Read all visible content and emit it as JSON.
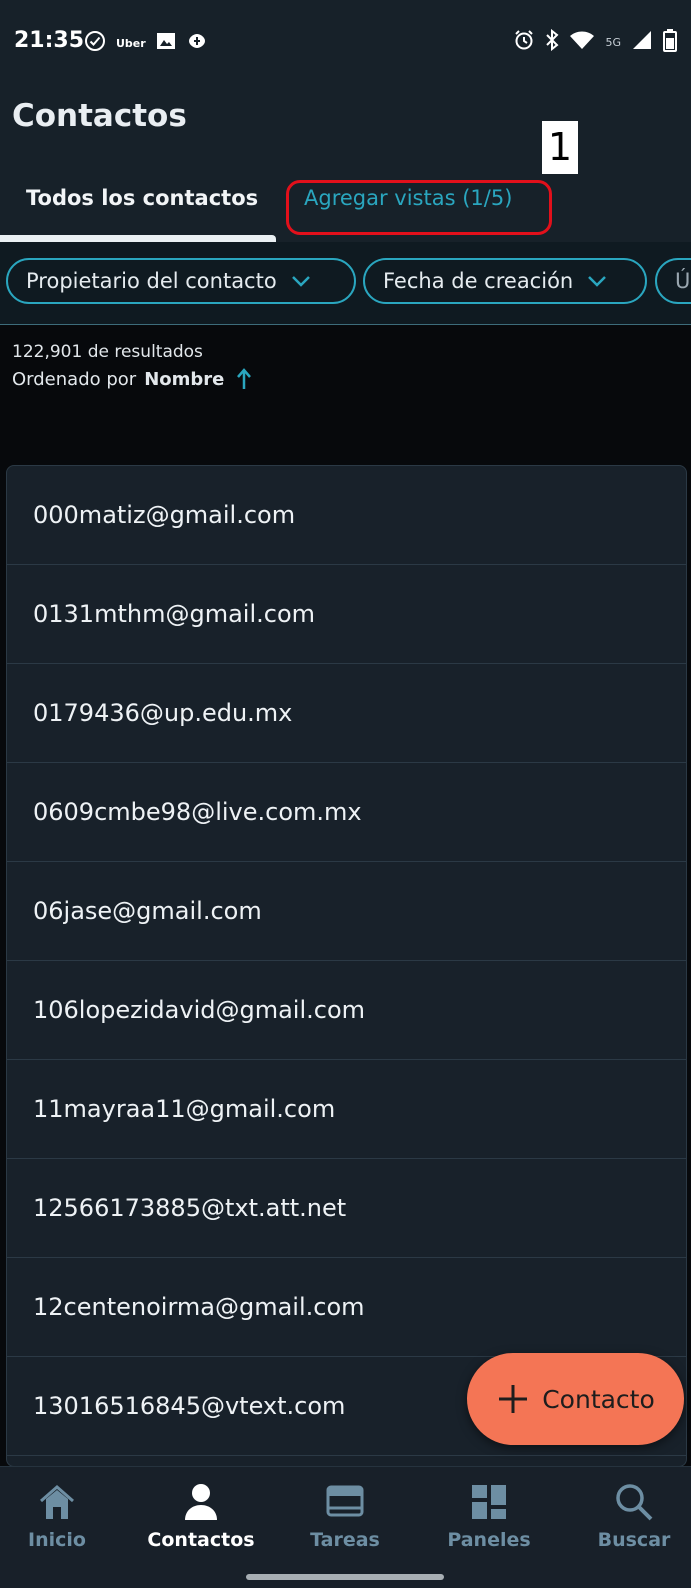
{
  "status_bar": {
    "time": "21:35",
    "uber_label": "Uber",
    "network": "5G",
    "left_icons": [
      "check-circle-icon",
      "uber-icon",
      "image-icon",
      "app-icon"
    ],
    "right_icons": [
      "alarm-icon",
      "bluetooth-icon",
      "wifi-icon",
      "signal-icon",
      "battery-icon"
    ]
  },
  "header": {
    "title": "Contactos",
    "tabs": [
      {
        "label": "Todos los contactos",
        "active": true
      },
      {
        "label": "Agregar vistas (1/5)",
        "active": false
      }
    ]
  },
  "annotation": {
    "label": "1",
    "ring_color": "#e2101b"
  },
  "filters": {
    "chips": [
      {
        "label": "Propietario del contacto"
      },
      {
        "label": "Fecha de creación"
      },
      {
        "label": "Ú"
      }
    ]
  },
  "results": {
    "count_text": "122,901 de resultados",
    "sort_prefix": "Ordenado por",
    "sort_value": "Nombre"
  },
  "contacts": [
    "000matiz@gmail.com",
    "0131mthm@gmail.com",
    "0179436@up.edu.mx",
    "0609cmbe98@live.com.mx",
    "06jase@gmail.com",
    "106lopezidavid@gmail.com",
    "11mayraa11@gmail.com",
    "12566173885@txt.att.net",
    "12centenoirma@gmail.com",
    "13016516845@vtext.com"
  ],
  "fab": {
    "label": "Contacto",
    "icon": "plus-icon"
  },
  "bottom_nav": {
    "items": [
      {
        "label": "Inicio",
        "icon": "home-icon"
      },
      {
        "label": "Contactos",
        "icon": "person-icon",
        "active": true
      },
      {
        "label": "Tareas",
        "icon": "tasks-icon"
      },
      {
        "label": "Paneles",
        "icon": "dashboard-icon"
      },
      {
        "label": "Buscar",
        "icon": "search-icon"
      }
    ]
  },
  "colors": {
    "accent": "#2aa6bf",
    "fab": "#f47555",
    "header_bg": "#172129",
    "list_bg": "#18212a"
  }
}
